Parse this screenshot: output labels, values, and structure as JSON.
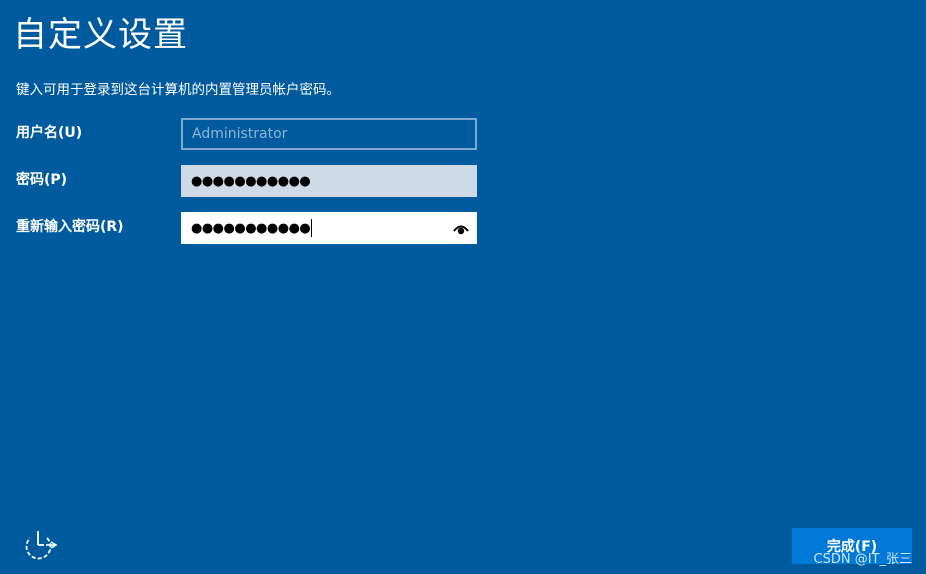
{
  "page": {
    "title": "自定义设置",
    "subtitle": "键入可用于登录到这台计算机的内置管理员帐户密码。"
  },
  "form": {
    "username": {
      "label": "用户名(U)",
      "placeholder": "Administrator",
      "value": ""
    },
    "password": {
      "label": "密码(P)",
      "masked_value": "●●●●●●●●●●●"
    },
    "reenter_password": {
      "label": "重新输入密码(R)",
      "masked_value": "●●●●●●●●●●●",
      "reveal_icon": "eye-icon"
    }
  },
  "footer": {
    "accessibility_icon": "ease-of-access-icon",
    "finish_label": "完成(F)",
    "watermark": "CSDN @IT_张三"
  },
  "colors": {
    "background": "#005a9e",
    "button": "#0078d7",
    "password_field_bg": "#cedbe7"
  }
}
